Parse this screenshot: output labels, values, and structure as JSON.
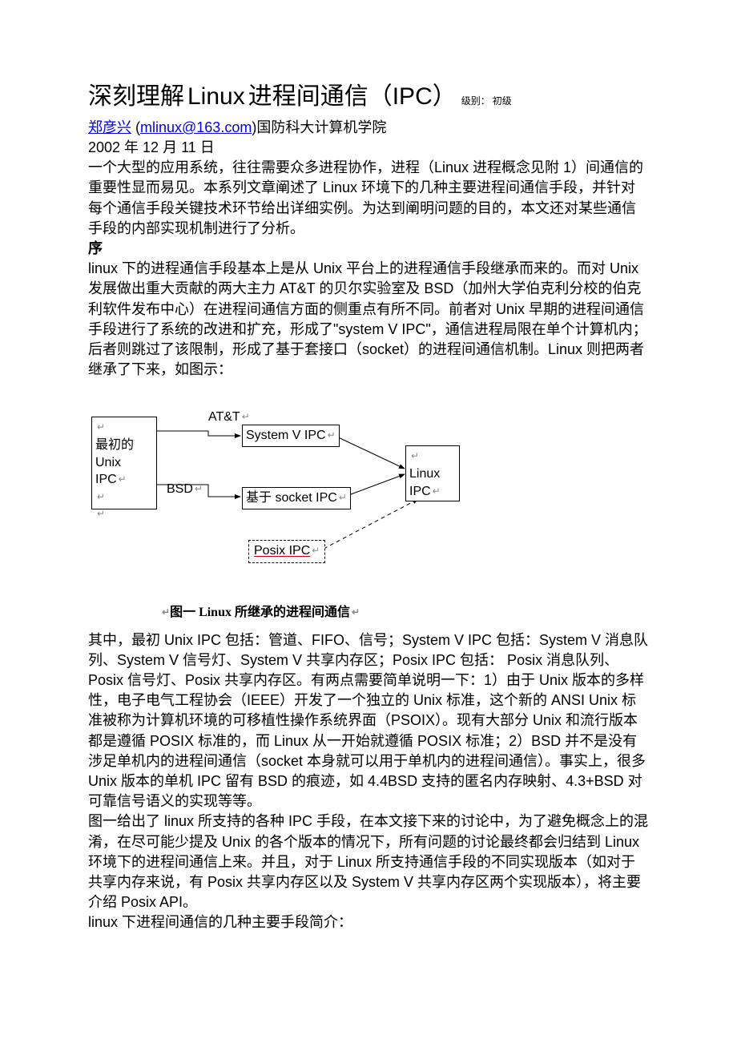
{
  "title": {
    "prefix": "深刻理解",
    "latin": "Linux",
    "mid": "进程间通信",
    "paren_open": "（",
    "abbr": "IPC",
    "paren_close": "）",
    "meta": "级别： 初级"
  },
  "byline": {
    "author": "郑彦兴",
    "paren_open": " (",
    "email": "mlinux@163.com",
    "paren_close": ")",
    "affiliation": "国防科大计算机学院"
  },
  "date": "2002 年 12 月 11 日",
  "intro": "一个大型的应用系统，往往需要众多进程协作，进程（Linux 进程概念见附 1）间通信的重要性显而易见。本系列文章阐述了 Linux 环境下的几种主要进程间通信手段，并针对每个通信手段关键技术环节给出详细实例。为达到阐明问题的目的，本文还对某些通信手段的内部实现机制进行了分析。",
  "section_head": "序",
  "para1": "linux 下的进程通信手段基本上是从 Unix 平台上的进程通信手段继承而来的。而对 Unix 发展做出重大贡献的两大主力 AT&T 的贝尔实验室及 BSD（加州大学伯克利分校的伯克利软件发布中心）在进程间通信方面的侧重点有所不同。前者对 Unix 早期的进程间通信手段进行了系统的改进和扩充，形成了\"system V IPC\"，通信进程局限在单个计算机内；后者则跳过了该限制，形成了基于套接口（socket）的进程间通信机制。Linux 则把两者继承了下来，如图示：",
  "diagram": {
    "box_left_lines": [
      "最初的",
      "Unix",
      "IPC"
    ],
    "label_att": "AT&T",
    "box_sysv": "System V IPC",
    "label_bsd": "BSD",
    "box_socket": "基于 socket IPC",
    "box_posix": "Posix IPC",
    "box_linux_lines": [
      "Linux",
      "IPC"
    ],
    "caption": "图一 Linux 所继承的进程间通信"
  },
  "para2": "其中，最初 Unix IPC 包括：管道、FIFO、信号；System V IPC 包括：System V 消息队列、System V 信号灯、System V 共享内存区；Posix IPC 包括： Posix 消息队列、Posix 信号灯、Posix 共享内存区。有两点需要简单说明一下：1）由于 Unix 版本的多样性，电子电气工程协会（IEEE）开发了一个独立的 Unix 标准，这个新的 ANSI Unix 标准被称为计算机环境的可移植性操作系统界面（PSOIX）。现有大部分 Unix 和流行版本都是遵循 POSIX 标准的，而 Linux 从一开始就遵循 POSIX 标准；2）BSD 并不是没有涉足单机内的进程间通信（socket 本身就可以用于单机内的进程间通信）。事实上，很多 Unix 版本的单机 IPC 留有 BSD 的痕迹，如 4.4BSD 支持的匿名内存映射、4.3+BSD 对可靠信号语义的实现等等。",
  "para3": "图一给出了 linux 所支持的各种 IPC 手段，在本文接下来的讨论中，为了避免概念上的混淆，在尽可能少提及 Unix 的各个版本的情况下，所有问题的讨论最终都会归结到 Linux 环境下的进程间通信上来。并且，对于 Linux 所支持通信手段的不同实现版本（如对于共享内存来说，有 Posix 共享内存区以及 System V 共享内存区两个实现版本），将主要介绍 Posix API。",
  "para4": "linux 下进程间通信的几种主要手段简介："
}
